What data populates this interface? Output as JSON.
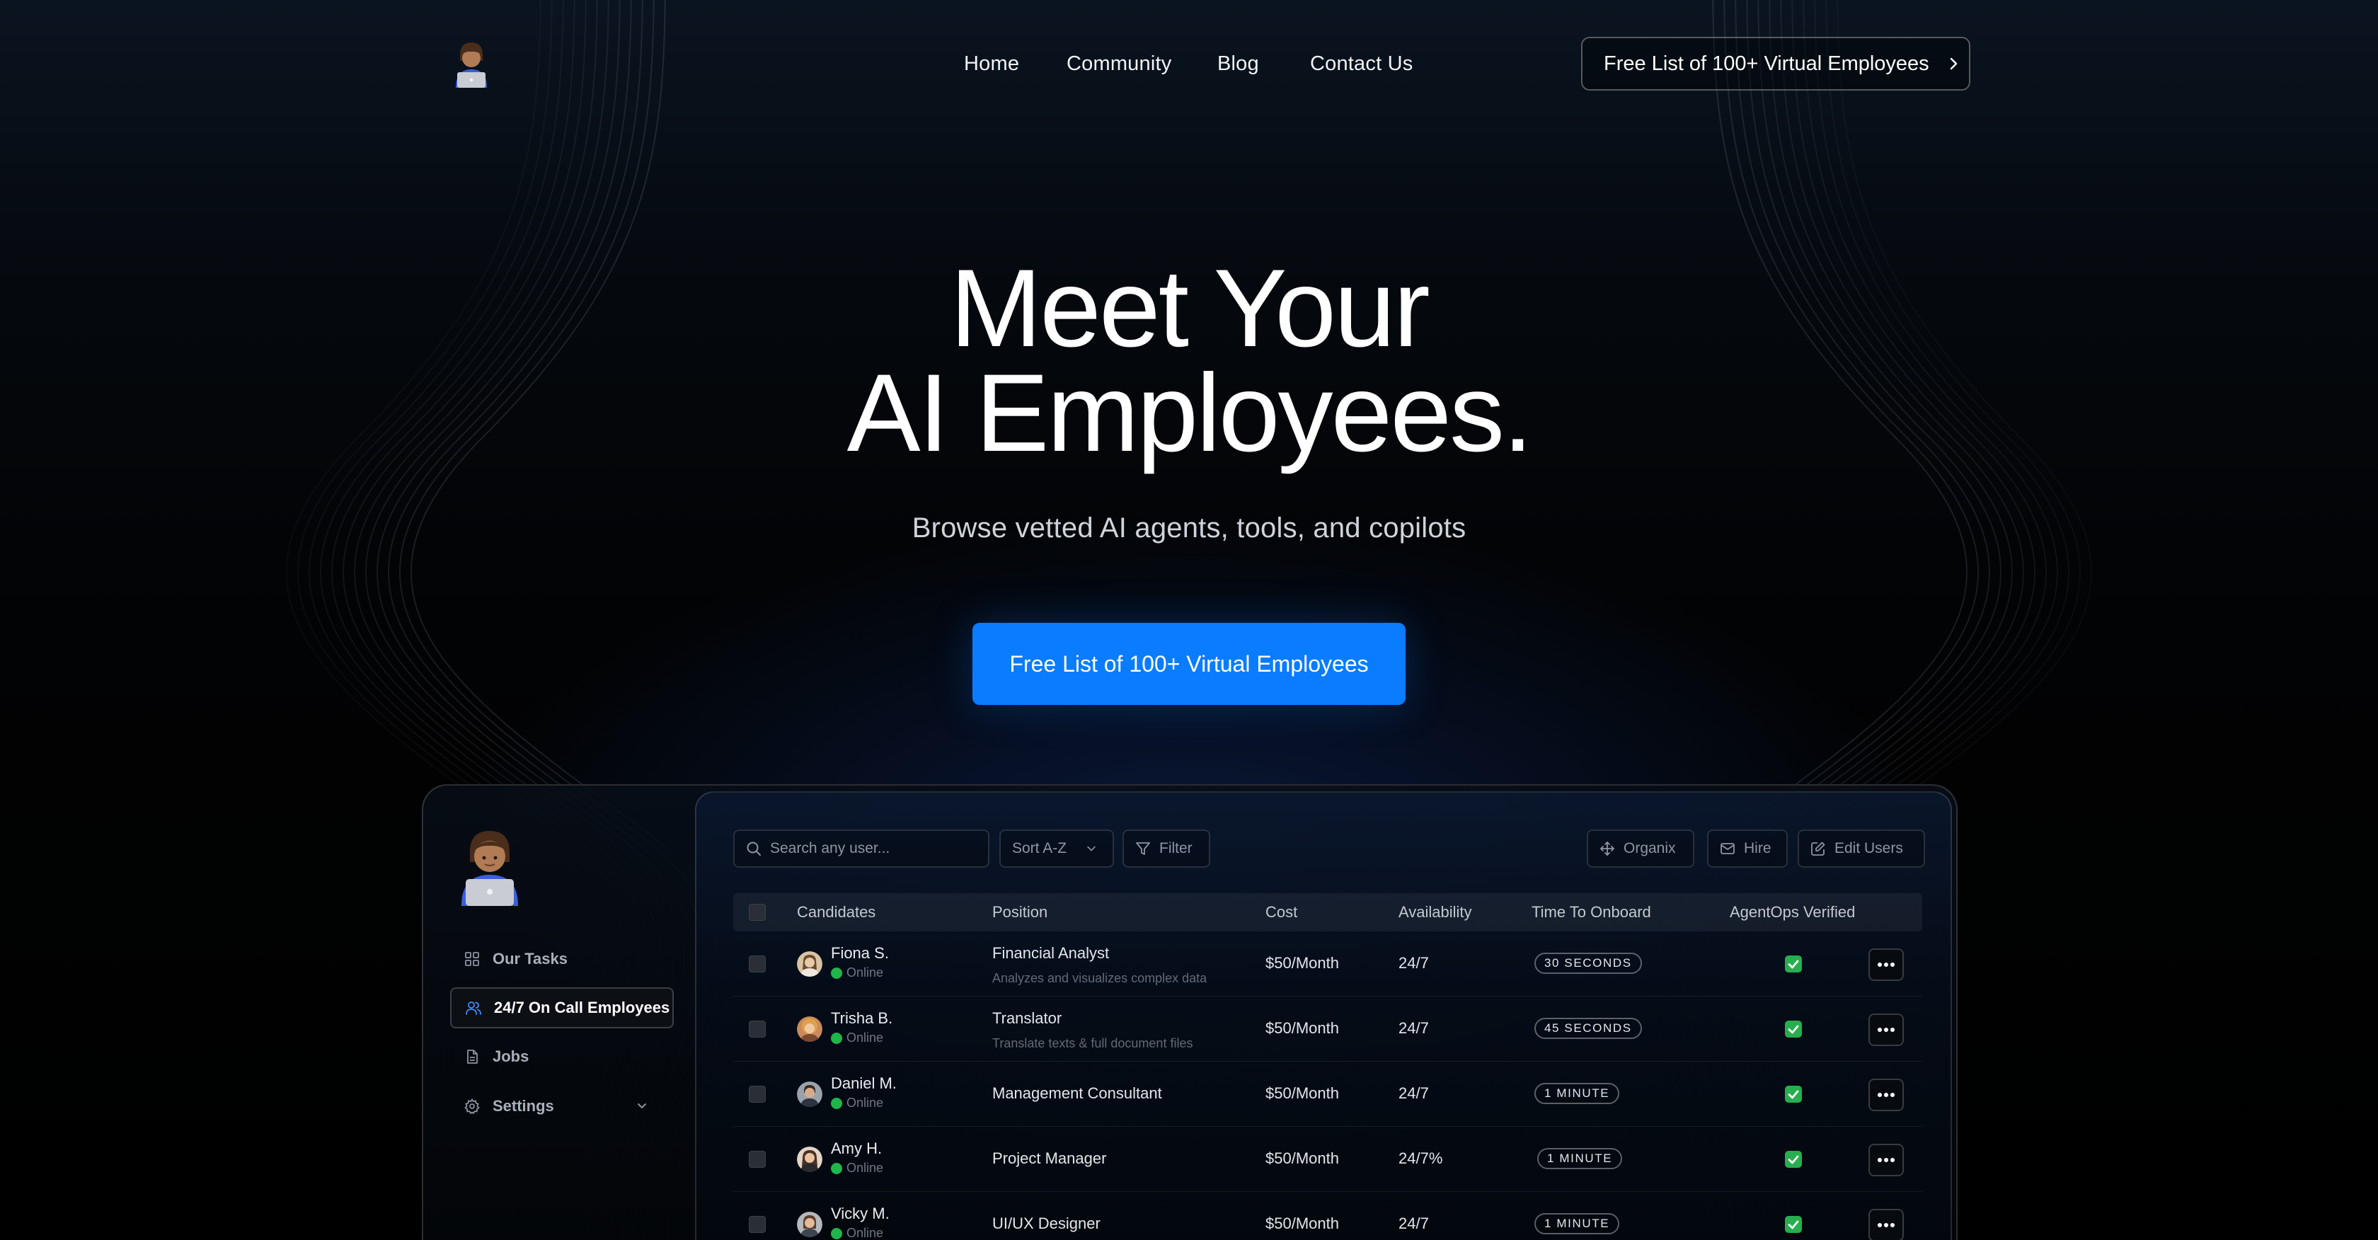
{
  "nav": {
    "logo_icon": "person-with-laptop-emoji",
    "links": [
      "Home",
      "Community",
      "Blog",
      "Contact Us"
    ],
    "cta_label": "Free List of 100+ Virtual Employees"
  },
  "hero": {
    "title_line1": "Meet Your",
    "title_line2": "AI Employees.",
    "subtitle": "Browse vetted AI agents, tools, and copilots",
    "cta_label": "Free List of 100+ Virtual Employees"
  },
  "app": {
    "sidebar": {
      "items": [
        {
          "label": "Our Tasks",
          "icon": "grid-icon"
        },
        {
          "label": "24/7 On Call Employees",
          "icon": "users-icon",
          "active": true
        },
        {
          "label": "Jobs",
          "icon": "document-icon"
        },
        {
          "label": "Settings",
          "icon": "gear-icon"
        }
      ]
    },
    "toolbar": {
      "search_placeholder": "Search any user...",
      "sort_label": "Sort A-Z",
      "filter_label": "Filter",
      "organix_label": "Organix",
      "hire_label": "Hire",
      "edit_label": "Edit Users"
    },
    "table": {
      "headers": [
        "Candidates",
        "Position",
        "Cost",
        "Availability",
        "Time To Onboard",
        "AgentOps Verified"
      ],
      "rows": [
        {
          "name": "Fiona S.",
          "status": "Online",
          "position": "Financial Analyst",
          "description": "Analyzes and visualizes complex data",
          "cost": "$50/Month",
          "availability": "24/7",
          "onboard": "30 SECONDS",
          "verified": true
        },
        {
          "name": "Trisha B.",
          "status": "Online",
          "position": "Translator",
          "description": "Translate texts & full document files",
          "cost": "$50/Month",
          "availability": "24/7",
          "onboard": "45 SECONDS",
          "verified": true
        },
        {
          "name": "Daniel M.",
          "status": "Online",
          "position": "Management Consultant",
          "description": "",
          "cost": "$50/Month",
          "availability": "24/7",
          "onboard": "1 MINUTE",
          "verified": true
        },
        {
          "name": "Amy H.",
          "status": "Online",
          "position": "Project Manager",
          "description": "",
          "cost": "$50/Month",
          "availability": "24/7%",
          "onboard": "1 MINUTE",
          "verified": true
        },
        {
          "name": "Vicky M.",
          "status": "Online",
          "position": "UI/UX Designer",
          "description": "",
          "cost": "$50/Month",
          "availability": "24/7",
          "onboard": "1 MINUTE",
          "verified": true
        }
      ]
    },
    "colors": {
      "accent": "#0a7cff",
      "online": "#1fb54a",
      "verified": "#27ae4e"
    }
  }
}
